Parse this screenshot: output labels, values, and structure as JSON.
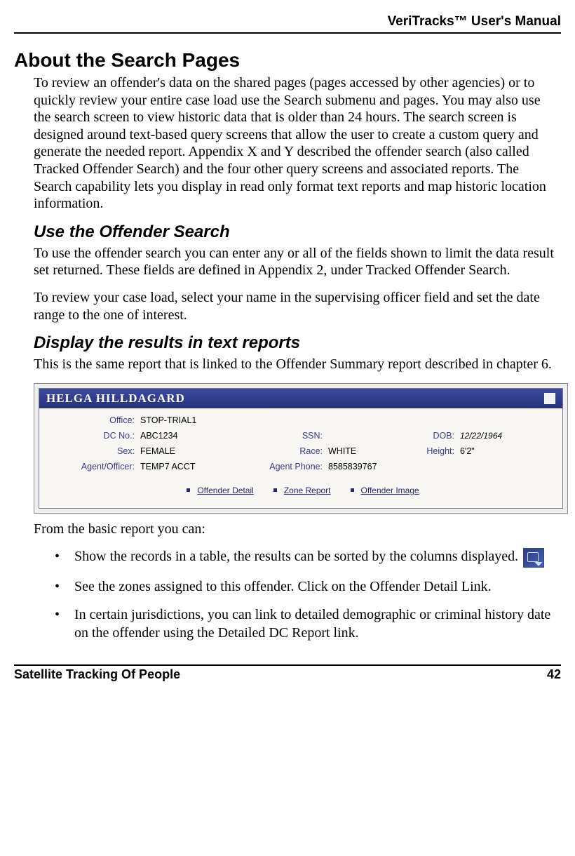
{
  "header": {
    "title": "VeriTracks™ User's Manual"
  },
  "h1": "About the Search Pages",
  "para1": "To review an offender's data on the shared pages (pages accessed by other agencies) or to quickly review your entire case load use the Search submenu and pages.  You may also use the search screen to view historic data that is older than 24 hours. The search screen is designed around text-based query screens that allow the user to create a custom query and generate the needed report.  Appendix X and Y described the offender search (also called Tracked Offender Search) and the four other query screens and associated reports.   The Search capability lets you display in read only format text reports and map historic location information.",
  "h2a": "Use the Offender Search",
  "para2": "To use the offender search you can enter any or all of the fields shown to limit the data result set returned.  These fields are defined in Appendix 2, under Tracked Offender Search.",
  "para3": "To review your case load, select your name in the supervising officer field and set the date range to the one of interest.",
  "h2b": "Display the results in text reports",
  "para4": "This is the same report that is linked to the Offender Summary report described in chapter 6.",
  "panel": {
    "name": "HELGA HILLDAGARD",
    "labels": {
      "office": "Office:",
      "dcno": "DC No.:",
      "ssn": "SSN:",
      "dob": "DOB:",
      "sex": "Sex:",
      "race": "Race:",
      "height": "Height:",
      "agent": "Agent/Officer:",
      "agent_phone": "Agent Phone:"
    },
    "values": {
      "office": "STOP-TRIAL1",
      "dcno": "ABC1234",
      "ssn": "",
      "dob": "12/22/1964",
      "sex": "FEMALE",
      "race": "WHITE",
      "height": "6'2\"",
      "agent": "TEMP7 ACCT",
      "agent_phone": "8585839767"
    },
    "links": {
      "detail": "Offender Detail",
      "zone": "Zone Report",
      "image": "Offender Image"
    }
  },
  "para5": "From the basic report you can:",
  "bullets": {
    "b1a": "Show the records in a table, the results can be sorted by the columns displayed.",
    "b2": "See the zones assigned to this offender.  Click on the Offender Detail Link.",
    "b3": "In certain jurisdictions, you can link to detailed demographic or criminal history date on the offender using the Detailed DC Report link."
  },
  "footer": {
    "left": "Satellite Tracking Of People",
    "right": "42"
  }
}
